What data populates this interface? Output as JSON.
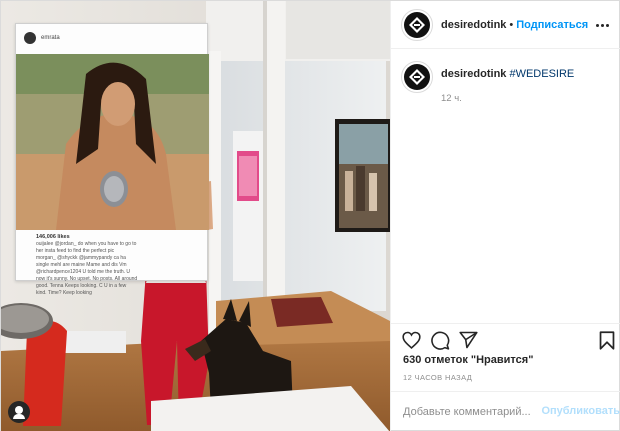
{
  "photo": {
    "poster_user": "emrata",
    "poster_likes": "146,006 likes",
    "poster_caption_lines": [
      "ouijalee @jordan_ do when you have to go to",
      "her insta feed to find the perfect pic",
      "morgan_ @shyckk @jammypandy ca ha",
      "single mehl are maine Mame and dis Vm",
      "@richardpence1204 U told me the truth. U",
      "now it's sunny. No upset. No posts. All around",
      "good. Tenna Keeps looking. C U in a few",
      "kind. Time? Keep looking"
    ]
  },
  "header": {
    "username": "desiredotink",
    "separator": "•",
    "follow_label": "Подписаться"
  },
  "caption": {
    "username": "desiredotink",
    "hashtag": "#WEDESIRE",
    "time": "12 ч."
  },
  "actions": {
    "like_icon": "heart-icon",
    "comment_icon": "comment-icon",
    "share_icon": "share-icon",
    "save_icon": "bookmark-icon"
  },
  "likes": {
    "count": "630 отметок",
    "suffix": "\"Нравится\""
  },
  "post_time": "12 ЧАСОВ НАЗАД",
  "comment": {
    "placeholder": "Добавьте комментарий...",
    "publish_label": "Опубликовать"
  },
  "colors": {
    "link_blue": "#0095f6",
    "hashtag_blue": "#00376b",
    "muted_grey": "#8e8e8e",
    "publish_disabled": "#b2dffc"
  }
}
